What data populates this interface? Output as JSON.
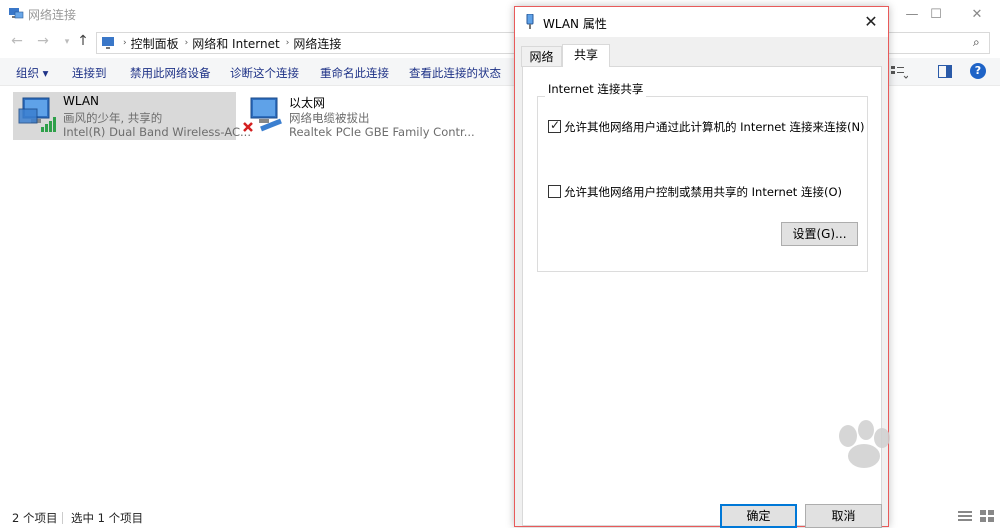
{
  "explorer": {
    "title": "网络连接",
    "breadcrumbs": [
      "控制面板",
      "网络和 Internet",
      "网络连接"
    ],
    "commands": [
      "组织 ▾",
      "连接到",
      "禁用此网络设备",
      "诊断这个连接",
      "重命名此连接",
      "查看此连接的状态"
    ],
    "items": [
      {
        "name": "WLAN",
        "status": "画风的少年, 共享的",
        "device": "Intel(R) Dual Band Wireless-AC..."
      },
      {
        "name": "以太网",
        "status": "网络电缆被拔出",
        "device": "Realtek PCIe GBE Family Contr..."
      }
    ],
    "status_count": "2 个项目",
    "status_selected": "选中 1 个项目",
    "help_label": "?"
  },
  "dialog": {
    "title": "WLAN 属性",
    "tabs": [
      "网络",
      "共享"
    ],
    "group_label": "Internet 连接共享",
    "allow_share": {
      "label": "允许其他网络用户通过此计算机的 Internet 连接来连接(N)",
      "checked": true
    },
    "allow_control": {
      "label": "允许其他网络用户控制或禁用共享的 Internet 连接(O)",
      "checked": false
    },
    "settings_button": "设置(G)...",
    "ok_button": "确定",
    "cancel_button": "取消",
    "close_glyph": "✕"
  },
  "colors": {
    "accent": "#0078d7",
    "link_text": "#1e3287",
    "dialog_border": "#e85a5a"
  }
}
